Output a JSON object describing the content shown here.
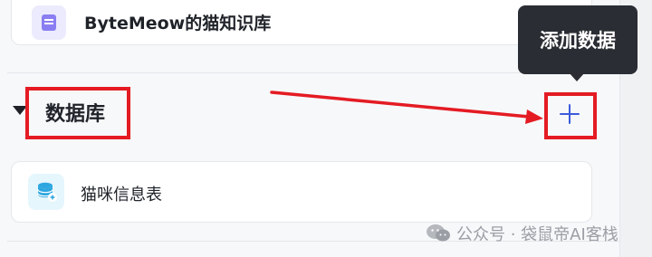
{
  "knowledge_base": {
    "name": "ByteMeow的猫知识库",
    "icon": "document-icon"
  },
  "database_section": {
    "title": "数据库",
    "add_icon": "plus-icon",
    "items": [
      {
        "name": "猫咪信息表",
        "icon": "database-icon"
      }
    ]
  },
  "tooltip": {
    "text": "添加数据"
  },
  "watermark": {
    "text": "公众号 · 袋鼠帝AI客栈"
  },
  "colors": {
    "accent": "#3b5bdb",
    "highlight": "#e41b23",
    "tooltip_bg": "#2a2d33",
    "kb_icon": "#8a7ef2",
    "db_icon": "#2ea7e0"
  }
}
